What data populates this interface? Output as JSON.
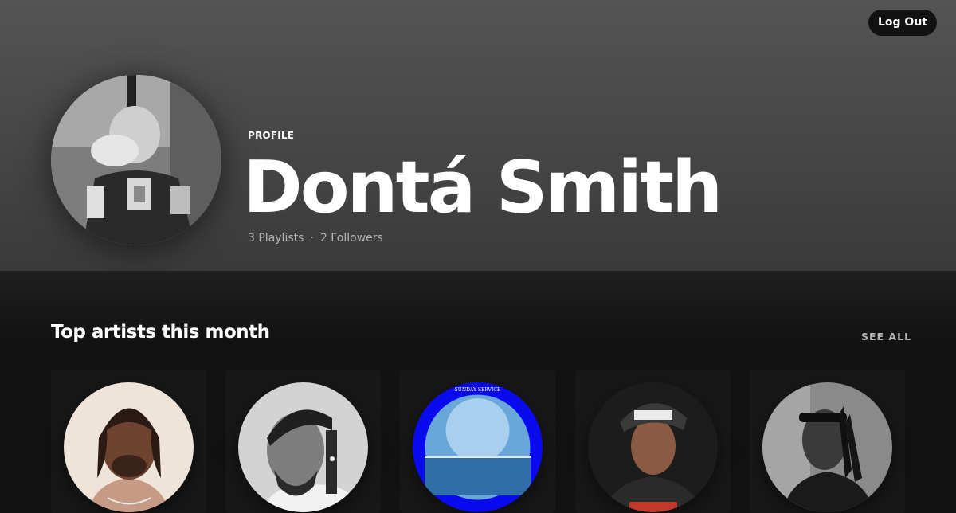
{
  "header": {
    "logout_label": "Log Out",
    "profile_label": "PROFILE",
    "name": "Dontá Smith",
    "playlists": "3 Playlists",
    "separator": "·",
    "followers": "2 Followers"
  },
  "top_artists": {
    "title": "Top artists this month",
    "see_all_label": "SEE ALL",
    "cards": [
      {
        "icon": "artist-portrait-icon"
      },
      {
        "icon": "artist-portrait-icon"
      },
      {
        "icon": "album-art-icon",
        "art_text": "SUNDAY SERVICE"
      },
      {
        "icon": "artist-portrait-icon"
      },
      {
        "icon": "artist-portrait-icon"
      }
    ]
  },
  "colors": {
    "header_top": "#545454",
    "header_bottom": "#3a3a3a",
    "background": "#121212",
    "card": "#181818",
    "muted_text": "#b3b3b3",
    "album_ring": "#0a0af0"
  }
}
